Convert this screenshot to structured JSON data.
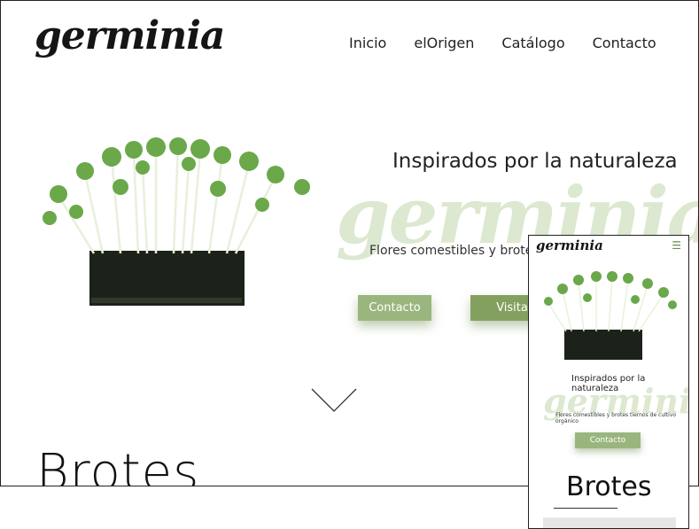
{
  "site": {
    "logo": "germinia"
  },
  "nav": {
    "items": [
      "Inicio",
      "elOrigen",
      "Catálogo",
      "Contacto"
    ]
  },
  "hero": {
    "tagline": "Inspirados por la naturaleza",
    "watermark": "germinia",
    "subline": "Flores comestibles y brotes tie",
    "buttons": {
      "contacto": "Contacto",
      "visitar": "Visitar nu"
    }
  },
  "section": {
    "heading": "Brotes"
  },
  "mobile": {
    "logo": "germinia",
    "tagline": "Inspirados por la naturaleza",
    "watermark": "germinia",
    "subline": "Flores comestibles y brotes tiernos de cultivo orgánico",
    "button": "Contacto",
    "heading": "Brotes"
  },
  "colors": {
    "accent": "#9ab67e",
    "accent_dark": "#84a05f",
    "watermark": "#dce8cf"
  }
}
